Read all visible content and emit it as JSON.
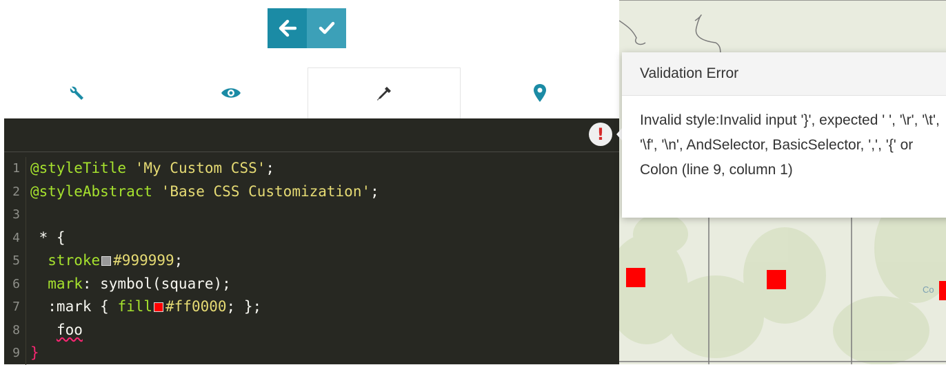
{
  "toolbar": {
    "back_icon": "arrow-left-icon",
    "confirm_icon": "check-icon",
    "colors": {
      "back": "#1b8ba5",
      "confirm": "#3ca0b8"
    }
  },
  "tabs": [
    {
      "icon": "wrench-icon",
      "active": false
    },
    {
      "icon": "eye-icon",
      "active": false
    },
    {
      "icon": "eyedropper-icon",
      "active": true
    },
    {
      "icon": "map-marker-icon",
      "active": false
    }
  ],
  "editor": {
    "error_indicator": "!",
    "lines": [
      {
        "num": "1",
        "parts": [
          {
            "t": "@styleTitle",
            "c": "kw"
          },
          {
            "t": " "
          },
          {
            "t": "'My Custom CSS'",
            "c": "str"
          },
          {
            "t": ";"
          }
        ]
      },
      {
        "num": "2",
        "parts": [
          {
            "t": "@styleAbstract",
            "c": "kw"
          },
          {
            "t": " "
          },
          {
            "t": "'Base CSS Customization'",
            "c": "str"
          },
          {
            "t": ";"
          }
        ]
      },
      {
        "num": "3",
        "parts": []
      },
      {
        "num": "4",
        "parts": [
          {
            "t": " * {"
          }
        ]
      },
      {
        "num": "5",
        "parts": [
          {
            "t": "  stroke",
            "c": "prop"
          },
          {
            "swatch": "#999999"
          },
          {
            "t": "#999999",
            "c": "str"
          },
          {
            "t": ";"
          }
        ]
      },
      {
        "num": "6",
        "parts": [
          {
            "t": "  mark",
            "c": "prop"
          },
          {
            "t": ": symbol(square);"
          }
        ]
      },
      {
        "num": "7",
        "parts": [
          {
            "t": "  :mark { "
          },
          {
            "t": "fill",
            "c": "prop"
          },
          {
            "swatch": "#ff0000"
          },
          {
            "t": "#ff0000",
            "c": "str"
          },
          {
            "t": "; };"
          }
        ]
      },
      {
        "num": "8",
        "parts": [
          {
            "t": "   "
          },
          {
            "t": "foo",
            "c": "squiggle"
          }
        ]
      },
      {
        "num": "9",
        "parts": [
          {
            "t": "}",
            "c": "brace-err"
          }
        ]
      }
    ]
  },
  "popup": {
    "title": "Validation Error",
    "message": "Invalid style:Invalid input '}', expected ' ', '\\r', '\\t', '\\f', '\\n', AndSelector, BasicSelector, ',', '{' or Colon (line 9, column 1)"
  },
  "map": {
    "labels": [
      "Co"
    ],
    "marker_color": "#ff0000"
  }
}
